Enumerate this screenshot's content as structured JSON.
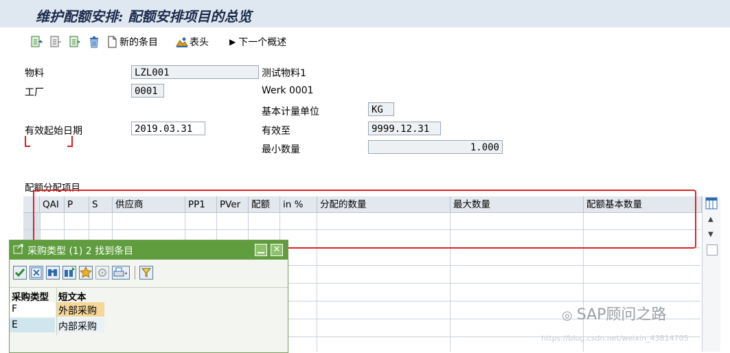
{
  "title": "维护配额安排: 配额安排项目的总览",
  "toolbar": {
    "new_entries": "新的条目",
    "header": "表头",
    "next_overview": "下一个概述"
  },
  "form": {
    "material_label": "物料",
    "material_value": "LZL001",
    "material_desc": "测试物料1",
    "plant_label": "工厂",
    "plant_value": "0001",
    "plant_desc": "Werk 0001",
    "base_unit_label": "基本计量单位",
    "base_unit_value": "KG",
    "valid_from_label": "有效起始日期",
    "valid_from_value": "2019.03.31",
    "valid_to_label": "有效至",
    "valid_to_value": "9999.12.31",
    "min_qty_label": "最小数量",
    "min_qty_value": "1.000"
  },
  "items_section_label": "配额分配项目",
  "grid": {
    "columns": [
      "QAI",
      "P",
      "S",
      "供应商",
      "PP1",
      "PVer",
      "配额",
      "in %",
      "分配的数量",
      "最大数量",
      "配额基本数量"
    ]
  },
  "popup": {
    "title": "采购类型 (1)   2 找到条目",
    "col_type": "采购类型",
    "col_text": "短文本",
    "rows": [
      {
        "code": "F",
        "text": "外部采购"
      },
      {
        "code": "E",
        "text": "内部采购"
      }
    ]
  },
  "watermark": {
    "brand": "SAP顾问之路",
    "url": "https://blog.csdn.net/weixin_43814705"
  },
  "colors": {
    "highlight_red": "#e02020",
    "popup_green": "#5f9d3e"
  }
}
